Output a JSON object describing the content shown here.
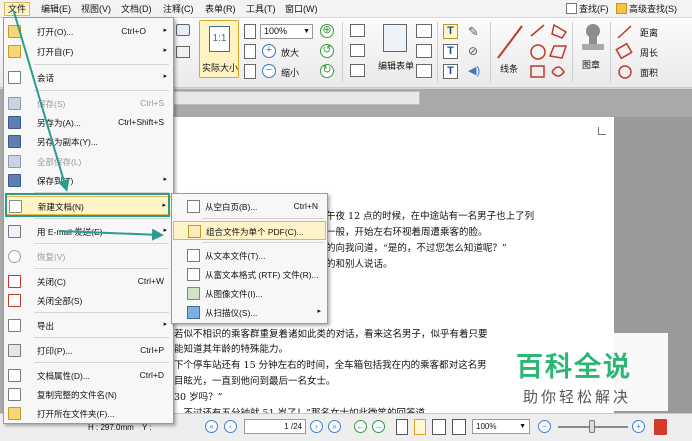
{
  "menubar": {
    "items": [
      "文件",
      "编辑(E)",
      "视图(V)",
      "文档(D)",
      "注释(C)",
      "表单(R)",
      "工具(T)",
      "窗口(W)"
    ],
    "find": "查找(F)",
    "advanced_find": "高级查找(S)"
  },
  "ribbon": {
    "zoom_value": "100%",
    "actual_size_page": "1:1",
    "actual_size": "实际大小",
    "zoom_in": "放大",
    "zoom_out": "缩小",
    "edit_form": "编辑表单",
    "lines": "线条",
    "stamp": "图章",
    "distance": "距离",
    "perimeter": "周长",
    "area": "面积"
  },
  "file_menu": {
    "items": [
      {
        "label": "打开(O)...",
        "shortcut": "Ctrl+O",
        "arrow": "▸",
        "icon": "open-folder-icon"
      },
      {
        "label": "打开自(F)",
        "shortcut": "",
        "arrow": "▸",
        "icon": "open-from-icon"
      },
      {
        "label": "会话",
        "shortcut": "",
        "arrow": "▸",
        "icon": "session-icon"
      },
      {
        "label": "保存(S)",
        "shortcut": "Ctrl+S",
        "arrow": "",
        "icon": "save-icon",
        "disabled": true
      },
      {
        "label": "另存为(A)...",
        "shortcut": "Ctrl+Shift+S",
        "arrow": "",
        "icon": "save-as-icon"
      },
      {
        "label": "另存为副本(Y)...",
        "shortcut": "",
        "arrow": "",
        "icon": "save-copy-icon"
      },
      {
        "label": "全部保存(L)",
        "shortcut": "",
        "arrow": "",
        "icon": "save-all-icon",
        "disabled": true
      },
      {
        "label": "保存到(T)",
        "shortcut": "",
        "arrow": "▸",
        "icon": "save-to-icon"
      },
      {
        "label": "新建文档(N)",
        "shortcut": "",
        "arrow": "▸",
        "icon": "new-document-icon",
        "highlight": true
      },
      {
        "label": "用 E-mail 发送(E)",
        "shortcut": "",
        "arrow": "▸",
        "icon": "email-icon"
      },
      {
        "label": "恢复(V)",
        "shortcut": "",
        "arrow": "",
        "icon": "revert-icon",
        "disabled": true
      },
      {
        "label": "关闭(C)",
        "shortcut": "Ctrl+W",
        "arrow": "",
        "icon": "close-document-icon"
      },
      {
        "label": "关闭全部(S)",
        "shortcut": "",
        "arrow": "",
        "icon": "close-all-icon"
      },
      {
        "label": "导出",
        "shortcut": "",
        "arrow": "▸",
        "icon": "export-icon"
      },
      {
        "label": "打印(P)...",
        "shortcut": "Ctrl+P",
        "arrow": "",
        "icon": "print-icon"
      },
      {
        "label": "文档属性(D)...",
        "shortcut": "Ctrl+D",
        "arrow": "",
        "icon": "properties-icon"
      },
      {
        "label": "复制完整的文件名(N)",
        "shortcut": "",
        "arrow": "",
        "icon": "copy-filename-icon"
      },
      {
        "label": "打开所在文件夹(F)...",
        "shortcut": "",
        "arrow": "",
        "icon": "containing-folder-icon"
      }
    ]
  },
  "submenu": {
    "items": [
      {
        "label": "从空白页(B)...",
        "shortcut": "Ctrl+N",
        "arrow": "",
        "icon": "blank-page-icon"
      },
      {
        "label": "组合文件为单个 PDF(C)...",
        "shortcut": "",
        "arrow": "",
        "icon": "combine-files-icon",
        "highlight": true
      },
      {
        "label": "从文本文件(T)...",
        "shortcut": "",
        "arrow": "",
        "icon": "text-file-icon"
      },
      {
        "label": "从富文本格式 (RTF) 文件(R)...",
        "shortcut": "",
        "arrow": "",
        "icon": "rtf-file-icon"
      },
      {
        "label": "从图像文件(I)...",
        "shortcut": "",
        "arrow": "",
        "icon": "image-file-icon"
      },
      {
        "label": "从扫描仪(S)...",
        "shortcut": "",
        "arrow": "▸",
        "icon": "scanner-icon"
      }
    ]
  },
  "document": {
    "lines": [
      "午夜 12 点的时候，在中途站有一名男子也上了列",
      "一般，开始左右环视着周遭乘客的脸。",
      "的向我问道，“是的，不过您怎么知道呢？”",
      "的和别人说话。",
      "若似不相识的乘客群重复着诸如此类的对话，看来这名男子，似乎有着只要",
      "能知道其年龄的特殊能力。",
      "下个停车站还有 15 分钟左右的时间，全车箱包括我在内的乘客都对这名男",
      "目眩光，一直到他问到最后一名女士。",
      "30 岁吗？”",
      "，不过还有五分钟就 51 岁了！”那名女士如此微笑的回答道。"
    ]
  },
  "statusbar": {
    "page_height": "H : 297.0mm",
    "y_label": "Y :",
    "page_number": "1 /",
    "page_total": "24",
    "zoom": "100%",
    "first_page": "«",
    "prev_page": "‹",
    "next_page": "›",
    "last_page": "»",
    "zoom_minus": "−",
    "zoom_plus": "+"
  },
  "watermark": {
    "title": "百科全说",
    "subtitle": "助你轻松解决"
  },
  "colors": {
    "annotation": "#2a9d8f",
    "highlight": "#fff4c8",
    "brand_green": "#2bb673"
  }
}
